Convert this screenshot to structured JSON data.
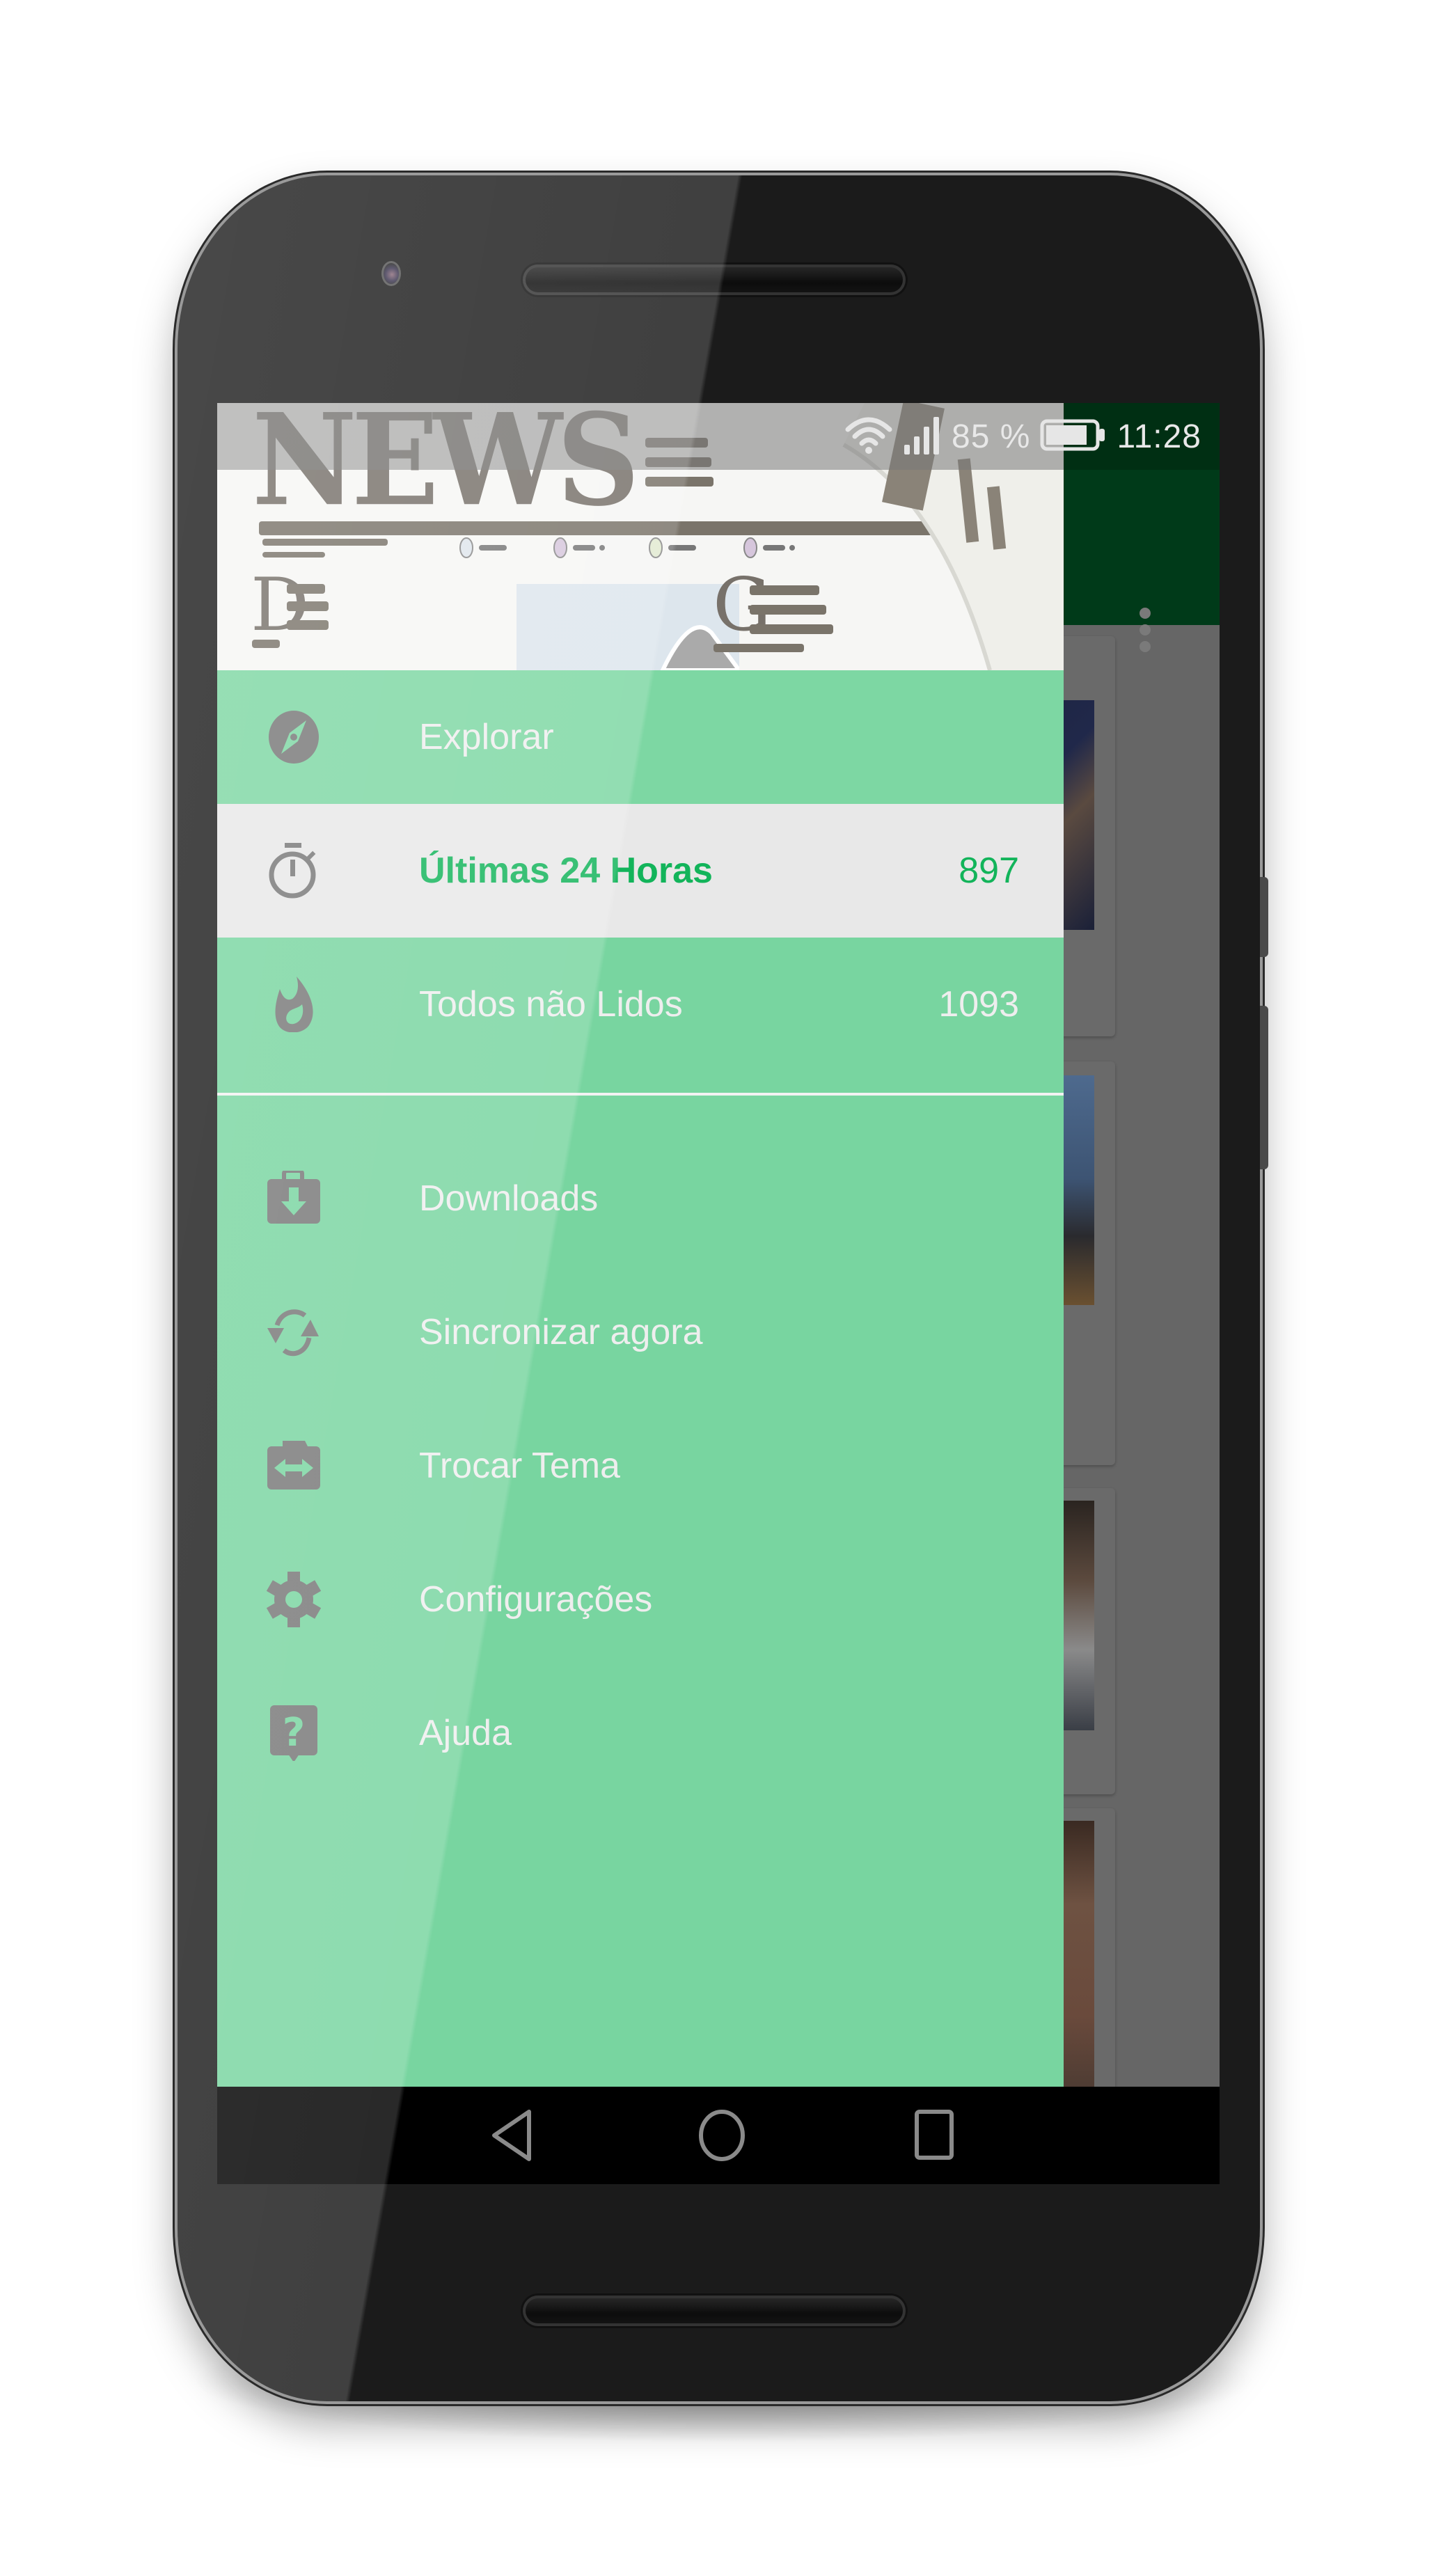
{
  "status_bar": {
    "wifi_icon": "wifi-icon",
    "signal_icon": "cell-signal-icon",
    "battery_percent": "85 %",
    "battery_icon": "battery-icon",
    "battery_level": 0.85,
    "time": "11:28"
  },
  "toolbar": {
    "overflow_icon": "more-vert-icon"
  },
  "drawer": {
    "header_image": {
      "description": "newspaper-illustration",
      "headline_text": "NEWS",
      "drop_caps": [
        "D",
        "G"
      ]
    },
    "primary_items": [
      {
        "label": "Explorar",
        "icon": "compass-icon",
        "count": null,
        "selected": false
      },
      {
        "label": "Últimas 24 Horas",
        "icon": "stopwatch-icon",
        "count": "897",
        "selected": true
      },
      {
        "label": "Todos não Lidos",
        "icon": "flame-icon",
        "count": "1093",
        "selected": false
      }
    ],
    "secondary_items": [
      {
        "label": "Downloads",
        "icon": "download-bag-icon"
      },
      {
        "label": "Sincronizar agora",
        "icon": "sync-icon"
      },
      {
        "label": "Trocar Tema",
        "icon": "swap-theme-icon"
      },
      {
        "label": "Configurações",
        "icon": "gear-icon"
      },
      {
        "label": "Ajuda",
        "icon": "help-icon"
      }
    ]
  },
  "background_feed": {
    "cards": [
      {
        "thumbnail": "man-gesturing-at-forum-photo"
      },
      {
        "thumbnail": "officials-at-conference-table-photo"
      },
      {
        "thumbnail": "man-in-suit-smiling-photo"
      },
      {
        "thumbnail": "young-man-portrait-photo"
      }
    ]
  },
  "nav_bar": {
    "back": "back-icon",
    "home": "home-icon",
    "recents": "recents-icon"
  },
  "colors": {
    "drawer_background": "#78d5a0",
    "selected_row_background": "#e8e8e8",
    "selected_accent": "#12b45a",
    "menu_text": "#eeeeee",
    "icon_gray": "#777777",
    "toolbar_dimmed": "#003a19"
  }
}
